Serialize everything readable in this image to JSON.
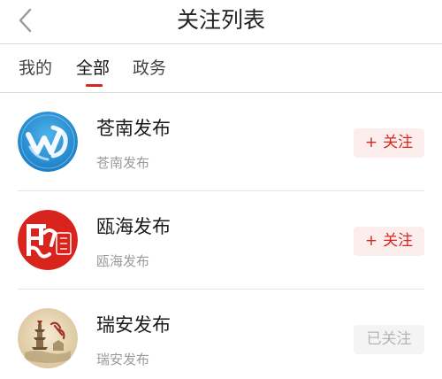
{
  "header": {
    "title": "关注列表",
    "back_icon": "chevron-left-icon"
  },
  "tabs": [
    {
      "label": "我的",
      "active": false
    },
    {
      "label": "全部",
      "active": true
    },
    {
      "label": "政务",
      "active": false
    }
  ],
  "colors": {
    "accent": "#d9261c",
    "follow_bg": "#fdeeee",
    "followed_bg": "#f4f4f4",
    "followed_text": "#b5b5b5"
  },
  "accounts": [
    {
      "name": "苍南发布",
      "subtitle": "苍南发布",
      "avatar_icon": "cangnan-logo-icon",
      "button_label": "关注",
      "button_plus": "+",
      "followed": false
    },
    {
      "name": "瓯海发布",
      "subtitle": "瓯海发布",
      "avatar_icon": "ouhai-seal-logo-icon",
      "button_label": "关注",
      "button_plus": "+",
      "followed": false
    },
    {
      "name": "瑞安发布",
      "subtitle": "瑞安发布",
      "avatar_icon": "ruian-pagoda-logo-icon",
      "button_label": "已关注",
      "followed": true
    }
  ]
}
